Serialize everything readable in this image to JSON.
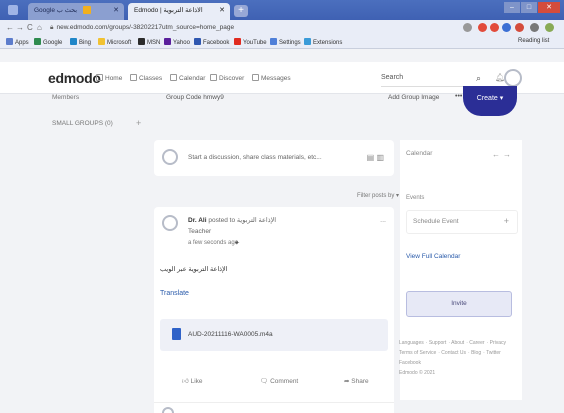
{
  "browser": {
    "tabs": [
      {
        "title": "Google بحث ب",
        "active": false
      },
      {
        "title": "Edmodo | الاذاعة التربوية",
        "active": true
      }
    ],
    "new_tab": "+",
    "window_controls": [
      "–",
      "□",
      "✕"
    ],
    "url": "new.edmodo.com/groups/-38202217utm_source=home_page",
    "nav": [
      "←",
      "→",
      "C",
      "⌂"
    ],
    "bookmarks": [
      "Apps",
      "Google",
      "Bing",
      "Microsoft",
      "MSN",
      "Yahoo",
      "Facebook",
      "YouTube",
      "Settings",
      "Extensions"
    ],
    "reading_list": "Reading list"
  },
  "header": {
    "logo": "edmodo",
    "nav": [
      "Home",
      "Classes",
      "Calendar",
      "Discover",
      "Messages"
    ],
    "search_placeholder": "Search"
  },
  "left": {
    "members": "Members",
    "small_groups": "SMALL GROUPS (0)"
  },
  "group_header": {
    "group_code": "Group Code hmwy9",
    "add_image": "Add Group Image",
    "create_label": "Create ▾",
    "more": "•••"
  },
  "composer": {
    "placeholder": "Start a discussion, share class materials, etc..."
  },
  "filter_label": "Filter posts by ▾",
  "post": {
    "author": "Dr. Ali",
    "posted_to_text": "posted to",
    "group_name": "الإذاعة التربوية",
    "role": "Teacher",
    "time": "a few seconds ago",
    "more": "...",
    "body": "الإذاعة التربوية عبر الويب",
    "translate": "Translate",
    "attachment": "AUD-20211116-WA0005.m4a",
    "like": "Like",
    "comment": "Comment",
    "share": "Share"
  },
  "right": {
    "calendar": "Calendar",
    "events": "Events",
    "schedule_event": "Schedule Event",
    "view_full_calendar": "View Full Calendar",
    "invite": "Invite"
  },
  "footer": {
    "links": [
      "Languages",
      "Support",
      "About",
      "Career",
      "Privacy",
      "Terms of Service",
      "Contact Us",
      "Blog",
      "Twitter",
      "Facebook"
    ],
    "copyright": "Edmodo © 2021"
  },
  "colors": {
    "accent": "#2b2e96",
    "link": "#2b5cab",
    "chrome": "#3f61b3"
  }
}
